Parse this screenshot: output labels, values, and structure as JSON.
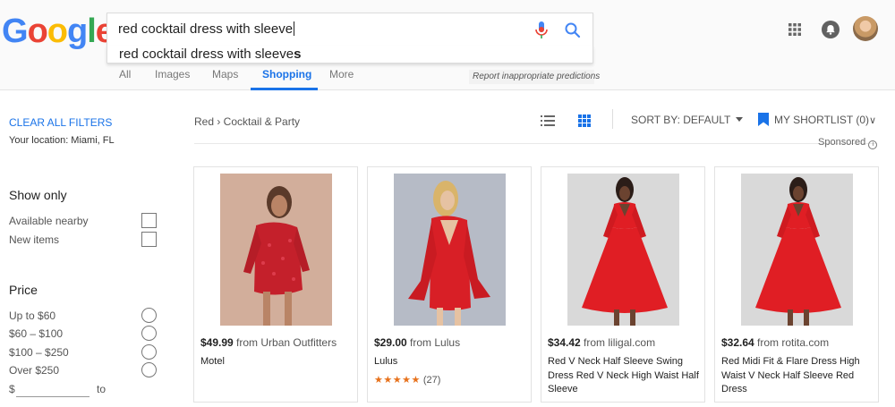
{
  "search": {
    "query": "red cocktail dress with sleeve",
    "suggestion_prefix": "red cocktail dress with sleeve",
    "suggestion_suffix": "s",
    "report_text": "Report inappropriate predictions"
  },
  "tabs": [
    {
      "label": "All"
    },
    {
      "label": "Images"
    },
    {
      "label": "Maps"
    },
    {
      "label": "Shopping",
      "active": true
    },
    {
      "label": "More"
    }
  ],
  "sidebar": {
    "clear_filters": "CLEAR ALL FILTERS",
    "location": "Your location: Miami, FL",
    "show_only": {
      "title": "Show only",
      "options": [
        "Available nearby",
        "New items"
      ]
    },
    "price": {
      "title": "Price",
      "options": [
        "Up to $60",
        "$60 – $100",
        "$100 – $250",
        "Over $250"
      ],
      "min_label": "$",
      "to_label": "to"
    }
  },
  "main": {
    "breadcrumb": "Red › Cocktail & Party",
    "sort_label": "SORT BY: DEFAULT",
    "shortlist_label": "MY SHORTLIST (0)",
    "sponsored_label": "Sponsored"
  },
  "products": [
    {
      "price": "$49.99",
      "merchant": "from Urban Outfitters",
      "title": "Motel",
      "rating": null,
      "review_count": null,
      "image": "sequin-dress"
    },
    {
      "price": "$29.00",
      "merchant": "from Lulus",
      "title": "Lulus",
      "rating": 4.5,
      "stars": "★★★★★",
      "review_count": "(27)",
      "image": "bell-sleeve-dress"
    },
    {
      "price": "$34.42",
      "merchant": "from liligal.com",
      "title": "Red V Neck Half Sleeve Swing Dress Red V Neck High Waist Half Sleeve",
      "rating": null,
      "review_count": null,
      "image": "swing-dress"
    },
    {
      "price": "$32.64",
      "merchant": "from rotita.com",
      "title": "Red Midi Fit & Flare Dress High Waist V Neck Half Sleeve Red Dress",
      "rating": null,
      "review_count": null,
      "image": "swing-dress"
    }
  ],
  "colors": {
    "accent": "#1a73e8",
    "star": "#e7711b",
    "dress_red": "#d42a2a"
  },
  "logo": "Google"
}
